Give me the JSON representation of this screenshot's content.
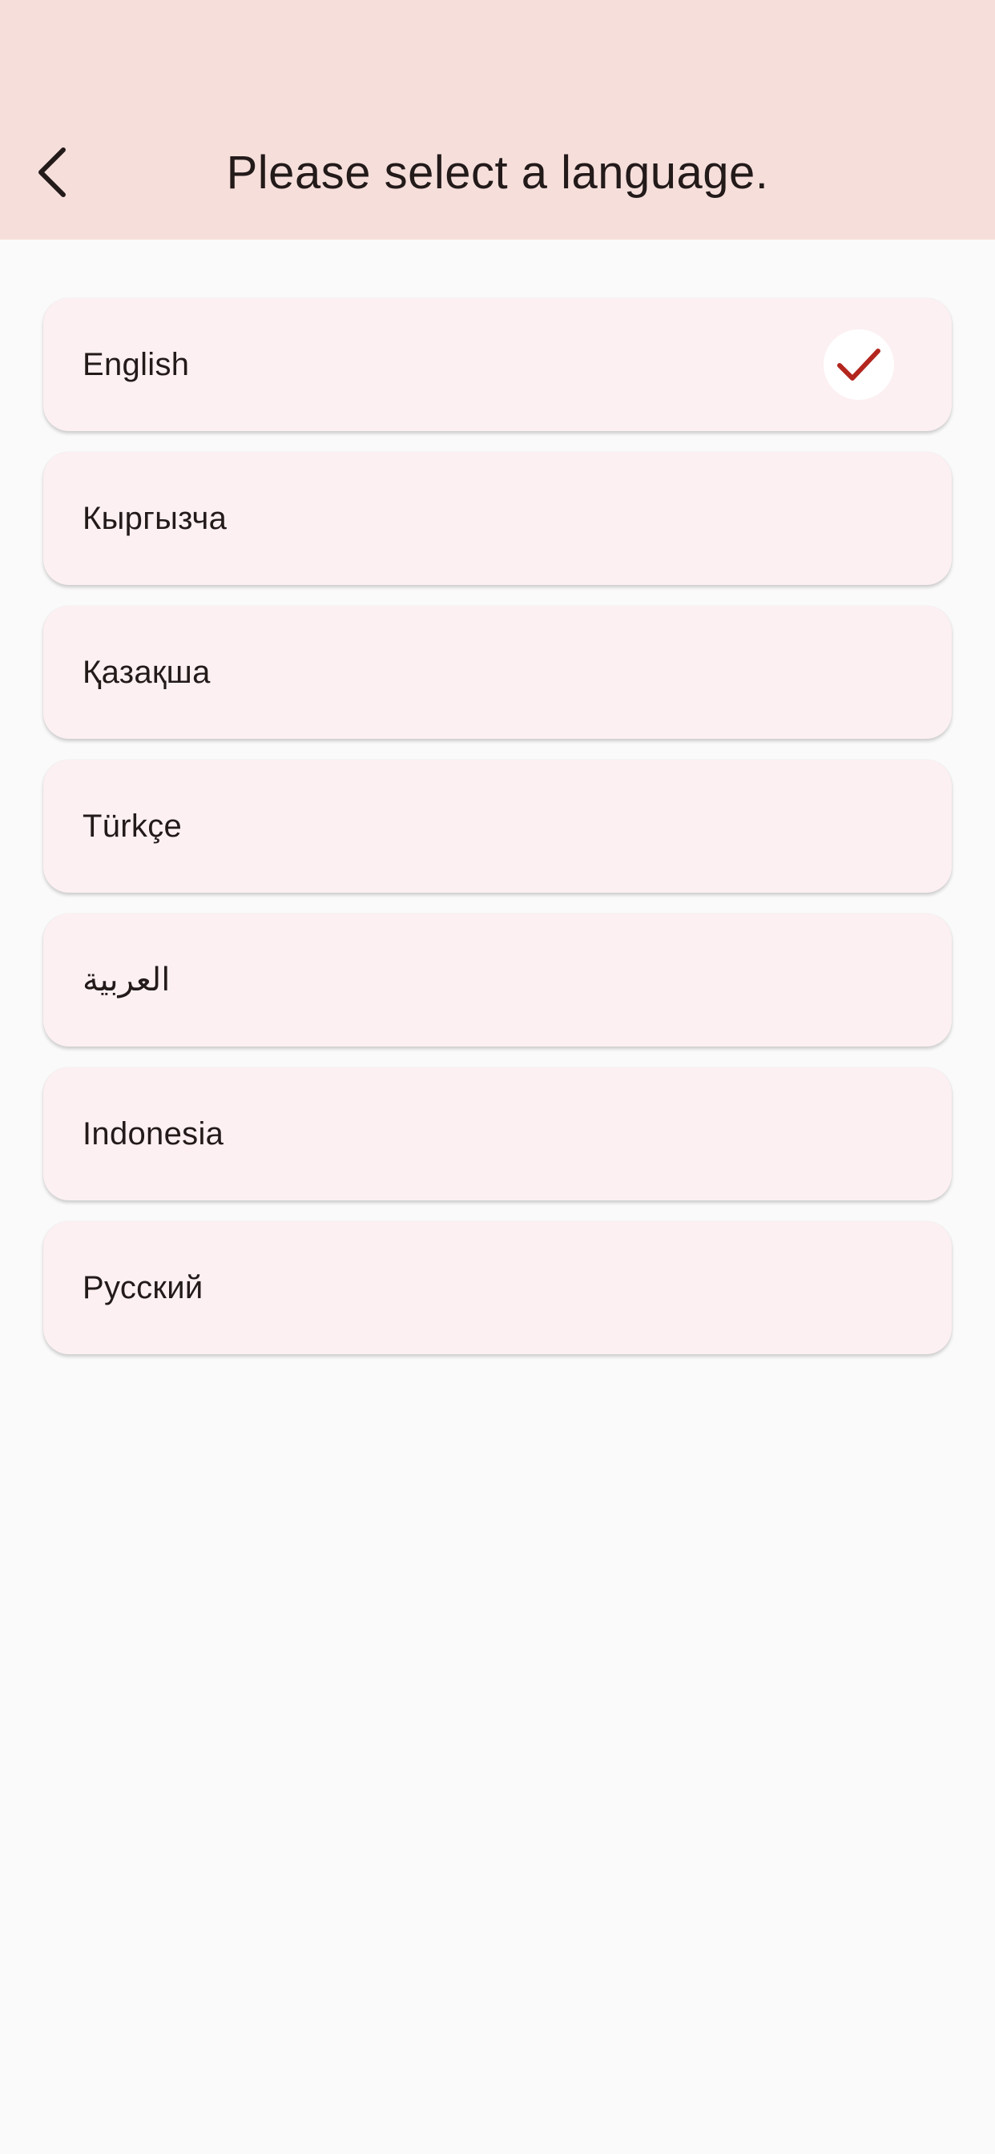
{
  "header": {
    "title": "Please select a language.",
    "back_icon": "chevron-left-icon",
    "background": "#f6dfdb"
  },
  "languages": [
    {
      "label": "English",
      "selected": true
    },
    {
      "label": "Кыргызча",
      "selected": false
    },
    {
      "label": "Қазақша",
      "selected": false
    },
    {
      "label": "Türkçe",
      "selected": false
    },
    {
      "label": "العربية",
      "selected": false
    },
    {
      "label": "Indonesia",
      "selected": false
    },
    {
      "label": "Русский",
      "selected": false
    }
  ],
  "selected_icon": "checkmark-icon",
  "colors": {
    "accent": "#b3261e",
    "card": "#fcf0f2",
    "text": "#231a1a"
  }
}
